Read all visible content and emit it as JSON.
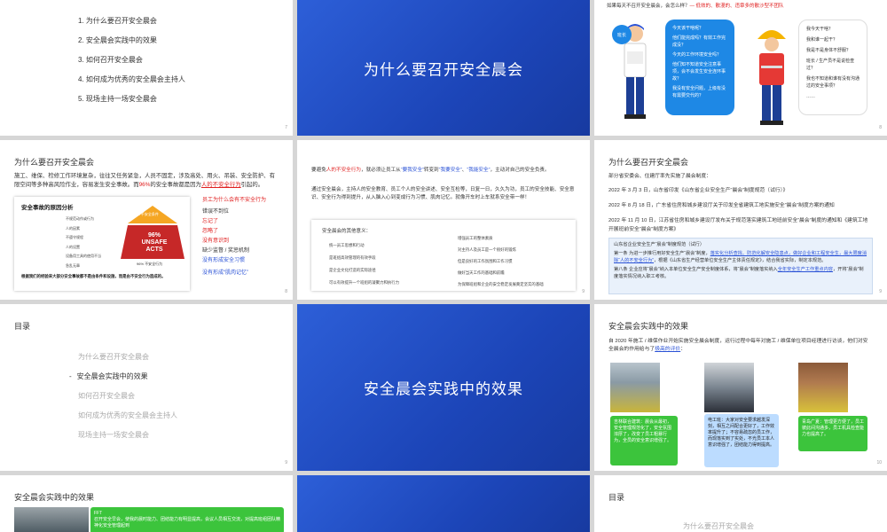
{
  "slide1": {
    "items": [
      "1.  为什么要召开安全晨会",
      "2.  安全晨会实践中的效果",
      "3.  如何召开安全晨会",
      "4.  如何成为优秀的安全晨会主持人",
      "5.  现场主持一场安全晨会"
    ],
    "page": "7"
  },
  "slide2": {
    "title": "为什么要召开安全晨会"
  },
  "slide3": {
    "header": "如果每天不召开安全晨会，会怎么样？",
    "header_red": "— 低效的、散漫的、违章多的散沙型不团队",
    "left_bubble": [
      "今天该干啥呢？",
      "他们能完成吗？有效工作完成没？",
      "今天的工作环境安全吗？",
      "他们知不知道安全注意事项，会不会发生安全连环事故？",
      "我没有安全问题，上级有没有需要交代的？"
    ],
    "left_label": "班长",
    "right_bubble": [
      "我今天干啥？",
      "我和谁一起干？",
      "我是不是身体不舒服？",
      "班长 / 生产员不是说检查过？",
      "我也不知道和谁有没有沟通过的安全事项？",
      "……"
    ],
    "page": "8"
  },
  "slide4": {
    "title": "为什么要召开安全晨会",
    "para1": "施工、维保、检修工作环境复杂，往往又任务紧急，人员不固定，涉及高处、用火、吊装、安全防护、有限空间等多种高风险作业，容易发生安全事故。而",
    "pct": "96%",
    "para1b": "的安全事故都是因为",
    "para1c": "人的不安全行为",
    "para1d": "引起的。",
    "box_title": "安全事故的原因分析",
    "causes": [
      "不规范动作或行为",
      "人的因素",
      "不遵守规程",
      "人的设置",
      "设备用工具的使用不当",
      "急乱无章"
    ],
    "pyramid_top": "4% 不安全条件",
    "pyramid_mid": "96% UNSAFE ACTS",
    "pyramid_bot": "96% 不安全行为",
    "box_note": "根据我们的经验来大部分安全事故都不是由条件和设施，而是由不安全行为造成的。",
    "right_title": "员工为什么会有不安全行为",
    "right_items": [
      "错误不到位",
      "忘记了",
      "忽略了",
      "没有意识到",
      "缺少监督 / 奖惩机制"
    ],
    "right_links": [
      "没有形成安全习惯",
      "没有形成“肌肉记忆”"
    ],
    "page": "8"
  },
  "slide5": {
    "line1a": "要避免",
    "line1b": "人的不安全行为",
    "line1c": "，就必须让员工从",
    "line1d": "“要我安全”",
    "line1e": "转变到",
    "line1f": "“我要安全”",
    "line1g": "、",
    "line1h": "“我能安全”",
    "line1i": "，主动对自己的安全负责。",
    "line2": "通过安全晨会，主持人的安全教育、员工个人的安全讲述、安全互检等，日复一日，久久为功，员工的安全技能、安全意识、安全行为得到提升，从入脑入心到变成行为习惯、肌肉记忆。就像开车时上车就系安全带一样！",
    "box_title": "安全晨会的其他意义：",
    "left_items": [
      "统一员工思想和行动",
      "是班组高效管理的有效手段",
      "是企业文化打造的实际途径",
      "可以有效提升一个班组的凝聚力和执行力"
    ],
    "right_items": [
      "增强员工的整体素质",
      "对主持人及员工是一个很好的锻炼",
      "但是良好的工作氛围和工作习惯",
      "做好当天工作的基础和前瞻",
      "为保障班组和企业的安全稳定发展奠定坚实的基础"
    ],
    "page": "9"
  },
  "slide6": {
    "title": "为什么要召开安全晨会",
    "l1": "部分省安委会、住建厅率先实施了晨会制度：",
    "l2": "2022 年 3 月 3 日，山东省印发《山东省企业安全生产“晨会”制度规范（试行）》",
    "l3": "2022 年 8 月 18 日，广东省住房和城乡建设厅关于印发全省建筑工地实施安全“晨会”制度方案的通知",
    "l4": "2022 年 11 月 10 日，江苏省住房和城乡建设厅发布关于规范落实建筑工地班前安全“晨会”制度的通知和《建筑工地开展班前安全“晨会”制度方案》",
    "q1": "山东省企业安全生产“晨会”制度规范（试行）",
    "q2": "第一条  为进一步推行用好安全生产“晨会”制度，",
    "q2b": "落实化分析查找、防范化解安全隐患点，做好企业和工程安全生，最大限度消除“人的不安全行为”",
    "q2c": "，根据《山东省生产经营单位安全生产主体责任规定》，结合我省实际，制定本规范。",
    "q3": "第八条  企业应将“晨会”纳入本单位安全生产安全制度体系，将“晨会”制度落实纳入",
    "q3b": "全年安全生产工作重点内容",
    "q3c": "，开将“晨会”制度落实情况纳入职工考核。",
    "page": "9"
  },
  "slide7": {
    "header": "目录",
    "items": [
      "为什么要召开安全晨会",
      "安全晨会实践中的效果",
      "如何召开安全晨会",
      "如何成为优秀的安全晨会主持人",
      "现场主持一场安全晨会"
    ],
    "active_marker": "-",
    "page": "9"
  },
  "slide8": {
    "title": "安全晨会实践中的效果"
  },
  "slide9": {
    "title": "安全晨会实践中的效果",
    "intro": "自 2020 年施工 / 维保作业开始实施安全晨会制度，运行过程中每年对施工 / 维保单位项目经理进行访谈，他们对安全晨会的作用给与了",
    "intro_link": "极高的评价",
    "intro_end": "：",
    "box1": "吉林联合建筑：晨会从最初，安全管理规范化了，安全氛围浓厚了，改变了员工粗暴行为，全员的安全意识增强了。",
    "box2": "电工班：大家对安全要求越发深刻，相互之间配合更好了，工作效率提升了；不容易疏忽的员工作，而现落实到了实处，不光员工本人意识增强了，团结能力得到提高。",
    "box3": "青岛广夏：管理更方便了，员工彼此间沟通多，员工机具检查能力也提高了。",
    "page": "10"
  },
  "slide10": {
    "title": "安全晨会实践中的效果",
    "box_title": "FFT",
    "box_text": "召开安全早会，使我的晨时能力、团结能力有明显提高，会议人员相互交流，对提高班组团队精神化安全管理起到"
  },
  "slide11": {},
  "slide12": {
    "header": "目录",
    "item1": "为什么要召开安全晨会"
  },
  "colors": {
    "bg_blue": "#2d5fd8",
    "accent_red": "#e02020",
    "accent_blue": "#2a52d6",
    "green": "#3cc43c"
  }
}
